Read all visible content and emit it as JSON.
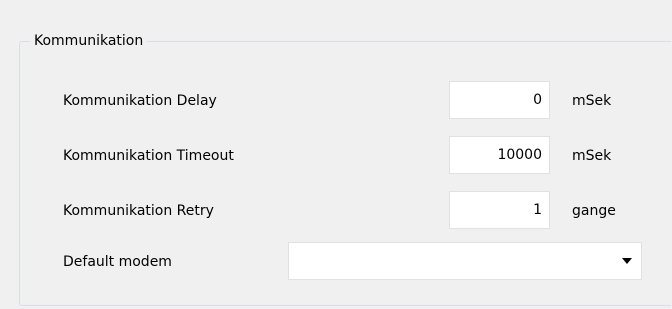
{
  "group": {
    "title": "Kommunikation"
  },
  "fields": {
    "delay": {
      "label": "Kommunikation Delay",
      "value": "0",
      "unit": "mSek"
    },
    "timeout": {
      "label": "Kommunikation Timeout",
      "value": "10000",
      "unit": "mSek"
    },
    "retry": {
      "label": "Kommunikation Retry",
      "value": "1",
      "unit": "gange"
    },
    "modem": {
      "label": "Default modem",
      "value": ""
    }
  },
  "icons": {
    "dropdown": "chevron-down-icon"
  },
  "colors": {
    "panel_background": "#f0f0f0",
    "groupbox_border": "#d5dfe5",
    "input_border": "#e1e1e1"
  }
}
